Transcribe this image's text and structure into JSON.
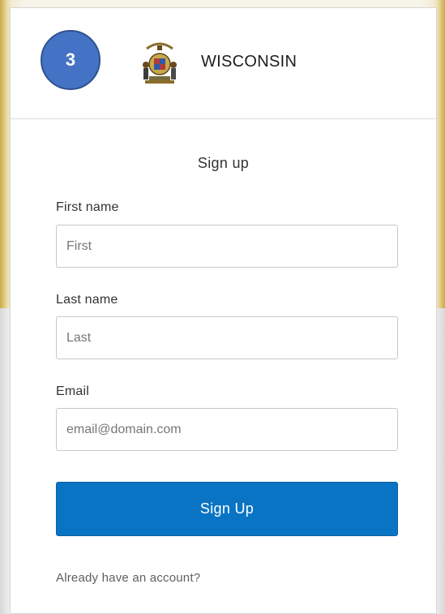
{
  "tutorial": {
    "step_number": "3"
  },
  "header": {
    "org_name": "WISCONSIN",
    "logo_icon": "state-seal-icon"
  },
  "form": {
    "title": "Sign up",
    "first_name": {
      "label": "First name",
      "placeholder": "First",
      "value": ""
    },
    "last_name": {
      "label": "Last name",
      "placeholder": "Last",
      "value": ""
    },
    "email": {
      "label": "Email",
      "placeholder": "email@domain.com",
      "value": ""
    },
    "submit_label": "Sign Up",
    "signin_link": "Already have an account?"
  },
  "colors": {
    "badge": "#4472c4",
    "primary_button": "#0a74c4",
    "frame_gold": "#c9a94a"
  }
}
